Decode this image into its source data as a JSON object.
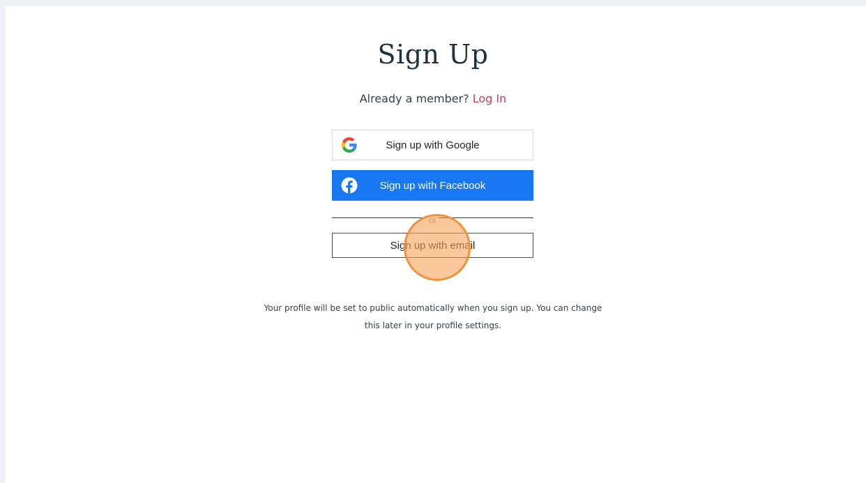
{
  "page": {
    "title": "Sign Up",
    "member_prompt": "Already a member?",
    "login_link": "Log In"
  },
  "buttons": {
    "google": {
      "label": "Sign up with Google",
      "icon": "google-icon"
    },
    "facebook": {
      "label": "Sign up with Facebook",
      "icon": "facebook-icon"
    },
    "email": {
      "label": "Sign up with email"
    }
  },
  "divider": {
    "label": "or"
  },
  "disclaimer": {
    "line1": "Your profile will be set to public automatically when you sign up. You can change",
    "line2": "this later in your profile settings."
  },
  "colors": {
    "page_background": "#eef2f7",
    "panel_background": "#ffffff",
    "link_accent": "#c2425e",
    "facebook_blue": "#1877f2",
    "click_indicator": "#f0923a"
  }
}
